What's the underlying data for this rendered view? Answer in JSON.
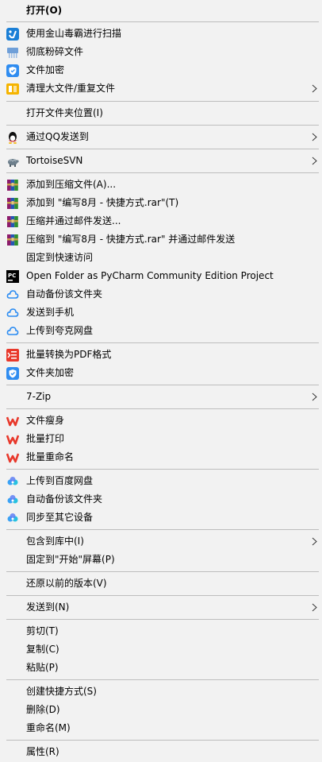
{
  "menu": {
    "items": [
      {
        "label": "打开(O)"
      },
      {
        "label": "使用金山毒霸进行扫描",
        "icon": "kingsoft-scan-icon"
      },
      {
        "label": "彻底粉碎文件",
        "icon": "shredder-icon"
      },
      {
        "label": "文件加密",
        "icon": "shield-lock-icon"
      },
      {
        "label": "清理大文件/重复文件",
        "icon": "cleanup-icon"
      },
      {
        "label": "打开文件夹位置(I)"
      },
      {
        "label": "通过QQ发送到",
        "icon": "qq-penguin-icon"
      },
      {
        "label": "TortoiseSVN",
        "icon": "tortoise-svn-icon"
      },
      {
        "label": "添加到压缩文件(A)...",
        "icon": "winrar-icon"
      },
      {
        "label": "添加到 \"编写8月 - 快捷方式.rar\"(T)",
        "icon": "winrar-icon"
      },
      {
        "label": "压缩并通过邮件发送...",
        "icon": "winrar-icon"
      },
      {
        "label": "压缩到 \"编写8月 - 快捷方式.rar\" 并通过邮件发送",
        "icon": "winrar-icon"
      },
      {
        "label": "固定到快速访问"
      },
      {
        "label": "Open Folder as PyCharm Community Edition Project",
        "icon": "pycharm-icon"
      },
      {
        "label": "自动备份该文件夹",
        "icon": "quark-cloud-icon"
      },
      {
        "label": "发送到手机",
        "icon": "quark-cloud-icon"
      },
      {
        "label": "上传到夸克网盘",
        "icon": "quark-cloud-icon"
      },
      {
        "label": "批量转换为PDF格式",
        "icon": "pdf-convert-icon"
      },
      {
        "label": "文件夹加密",
        "icon": "shield-lock-icon"
      },
      {
        "label": "7-Zip"
      },
      {
        "label": "文件瘦身",
        "icon": "wps-icon"
      },
      {
        "label": "批量打印",
        "icon": "wps-icon"
      },
      {
        "label": "批量重命名",
        "icon": "wps-icon"
      },
      {
        "label": "上传到百度网盘",
        "icon": "baidu-netdisk-icon"
      },
      {
        "label": "自动备份该文件夹",
        "icon": "baidu-netdisk-icon"
      },
      {
        "label": "同步至其它设备",
        "icon": "baidu-netdisk-icon"
      },
      {
        "label": "包含到库中(I)"
      },
      {
        "label": "固定到\"开始\"屏幕(P)"
      },
      {
        "label": "还原以前的版本(V)"
      },
      {
        "label": "发送到(N)"
      },
      {
        "label": "剪切(T)"
      },
      {
        "label": "复制(C)"
      },
      {
        "label": "粘贴(P)"
      },
      {
        "label": "创建快捷方式(S)"
      },
      {
        "label": "删除(D)"
      },
      {
        "label": "重命名(M)"
      },
      {
        "label": "属性(R)"
      }
    ]
  },
  "colors": {
    "background": "#f2f2f2",
    "separator": "#bdbdbd",
    "wps_red": "#e8382b",
    "quark_blue": "#2a8bf2",
    "shield_blue": "#2f8cf0"
  }
}
